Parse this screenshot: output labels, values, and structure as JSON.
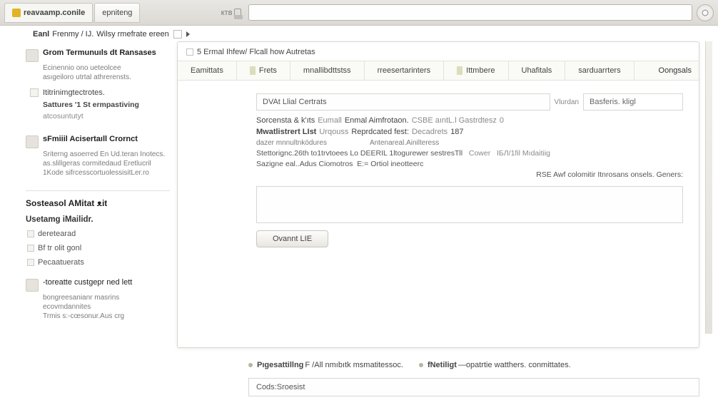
{
  "topbar": {
    "tabs": [
      {
        "label": "reavaamp.conile"
      },
      {
        "label": "epniteng"
      }
    ],
    "mid_label": "ктв",
    "search_placeholder": ""
  },
  "breadcrumb": {
    "a": "Eanl",
    "b": "Frenmy / IJ.",
    "c": "Wilsy rmefrate ereen"
  },
  "sidebar": {
    "block1": {
      "title": "Grom Termunuıls dt Ransases",
      "desc1": "Ecinennio ono ueteolcee",
      "desc2": "asıgeiloro utrtal athrerensts.",
      "items": [
        "Ititrinimgtectrotes.",
        "Sattures '1 St ermpastiving",
        "atcosuntutyt"
      ]
    },
    "block2": {
      "title": "sFmiiil Acisertaıll Crornct",
      "desc1": "Sriterng asoerred En Ud.teran Inotecs.",
      "desc2": "as.slillgeras cormitedaud Eretlucril",
      "desc3": "1Kode sifrcesscortuolessisitLer.ro"
    },
    "mail_hdr": "Sosteasol AMitat ᴥit",
    "using_hdr": "Usetamg iMailidr.",
    "links": [
      "deretearad",
      "Bf tr olit gonl",
      "Pecaatuerats"
    ],
    "block3": {
      "title": "-toreatte custgepr ned lett",
      "desc1": "bongreesanianr masrins",
      "desc2": "ecovmdannites",
      "desc3": "Trmis s:-cœsonur.Aus crg"
    }
  },
  "panel": {
    "title": "5 Ermal Ihfew/ Flcall how Autretas",
    "right_label": "Oongsals",
    "tabs": [
      "Eamittats",
      "Frets",
      "mnallibdttstss",
      "rreesertarinters",
      "Ittmbere",
      "Uhafitals",
      "sarduarrters"
    ],
    "form": {
      "field1_label": "DVAt Llial Certrats",
      "field1_side_lbl": "Vlurdan",
      "field1_side_val": "Basferis. kligl",
      "row2a": "Sorcensta & k'ıts",
      "row2b": "Eumall",
      "row2c": "Enmal Aimfrotaon.",
      "row2d": "CSBE aıntL.l Gastrdtesz",
      "row2e": "0",
      "row3a": "Mwatlistrert LIst",
      "row3b": "Urqouss",
      "row3c": "Reprdcated fest:",
      "row3d": "Decadrets",
      "row3e": "187",
      "sub_lbl_left": "dazer mnnultnködures",
      "sub_lbl_right": "Antenareal.Ainilteress",
      "r4": "Stettorignc.26th to1trvtoees Lo DEERIL 1ltogurewer sestresTll",
      "r4b": "Cower",
      "r4c": "IБЛ/1fil Mıdaitiig",
      "r5a": "Sazigne eal..Adus Ciomotros",
      "r5b": "E:= Ortiol ineotteerc",
      "r5c": "RSE Awf colomitir Itnrosans onsels. Geners:",
      "button": "Ovannt LIE"
    }
  },
  "footer": {
    "seg1a": "Pıgesattillng",
    "seg1b": "F /All nmıbıtk msmatitessoc.",
    "seg2a": "fNetiligt",
    "seg2b": "—opatrtie watthers. conmittates.",
    "box": "Cods:Sroesist"
  }
}
